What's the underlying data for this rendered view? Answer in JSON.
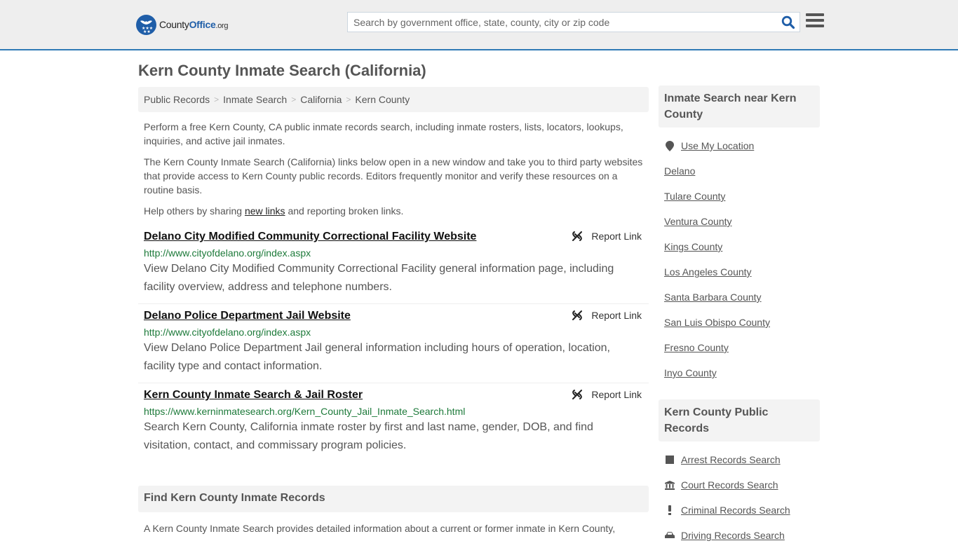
{
  "header": {
    "logo": {
      "county": "County",
      "office": "Office",
      "org": ".org"
    },
    "search": {
      "placeholder": "Search by government office, state, county, city or zip code",
      "value": ""
    },
    "icons": {
      "search": "search-icon",
      "menu": "hamburger-menu-icon"
    }
  },
  "page": {
    "title": "Kern County Inmate Search (California)"
  },
  "breadcrumb": [
    {
      "label": "Public Records"
    },
    {
      "label": "Inmate Search"
    },
    {
      "label": "California"
    },
    {
      "label": "Kern County"
    }
  ],
  "intro": {
    "p1": "Perform a free Kern County, CA public inmate records search, including inmate rosters, lists, locators, lookups, inquiries, and active jail inmates.",
    "p2": "The Kern County Inmate Search (California) links below open in a new window and take you to third party websites that provide access to Kern County public records. Editors frequently monitor and verify these resources on a routine basis.",
    "p3_before": "Help others by sharing ",
    "p3_link": "new links",
    "p3_after": " and reporting broken links."
  },
  "links": [
    {
      "title": "Delano City Modified Community Correctional Facility Website",
      "url": "http://www.cityofdelano.org/index.aspx",
      "description": "View Delano City Modified Community Correctional Facility general information page, including facility overview, address and telephone numbers.",
      "report_label": "Report Link"
    },
    {
      "title": "Delano Police Department Jail Website",
      "url": "http://www.cityofdelano.org/index.aspx",
      "description": "View Delano Police Department Jail general information including hours of operation, location, facility type and contact information.",
      "report_label": "Report Link"
    },
    {
      "title": "Kern County Inmate Search & Jail Roster",
      "url": "https://www.kerninmatesearch.org/Kern_County_Jail_Inmate_Search.html",
      "description": "Search Kern County, California inmate roster by first and last name, gender, DOB, and find visitation, contact, and commissary program policies.",
      "report_label": "Report Link"
    }
  ],
  "find_section": {
    "heading": "Find Kern County Inmate Records",
    "text": "A Kern County Inmate Search provides detailed information about a current or former inmate in Kern County,"
  },
  "sidebar": {
    "nearby": {
      "heading": "Inmate Search near Kern County",
      "use_location": "Use My Location",
      "items": [
        "Delano",
        "Tulare County",
        "Ventura County",
        "Kings County",
        "Los Angeles County",
        "Santa Barbara County",
        "San Luis Obispo County",
        "Fresno County",
        "Inyo County"
      ]
    },
    "public_records": {
      "heading": "Kern County Public Records",
      "items": [
        {
          "label": "Arrest Records Search",
          "icon": "square-icon"
        },
        {
          "label": "Court Records Search",
          "icon": "courthouse-icon"
        },
        {
          "label": "Criminal Records Search",
          "icon": "exclamation-icon"
        },
        {
          "label": "Driving Records Search",
          "icon": "car-icon"
        }
      ]
    }
  },
  "colors": {
    "brand_blue": "#1f5ea8",
    "header_border": "#2f7ab5",
    "url_green": "#1d7a3a",
    "panel_gray": "#f3f3f3"
  }
}
